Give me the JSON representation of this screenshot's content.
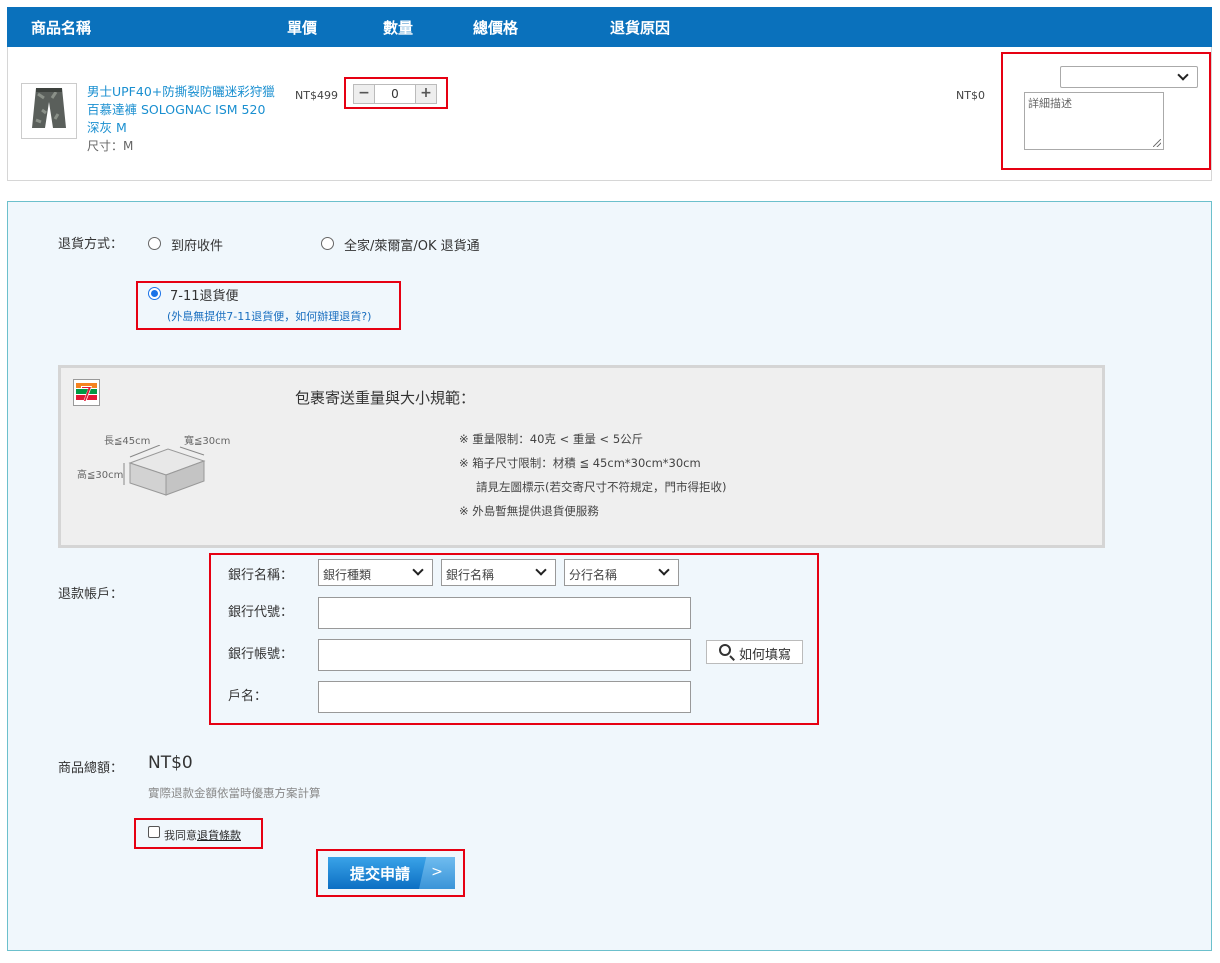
{
  "table": {
    "headers": [
      "商品名稱",
      "單價",
      "數量",
      "總價格",
      "退貨原因"
    ]
  },
  "product": {
    "name": "男士UPF40+防撕裂防曬迷彩狩獵百慕達褲 SOLOGNAC ISM 520 深灰 M",
    "size": "尺寸：M",
    "price": "NT$499",
    "qty": "0",
    "minus": "−",
    "plus": "+",
    "total": "NT$0",
    "reason_selected": "",
    "reason_placeholder": "詳細描述"
  },
  "return_method": {
    "label": "退貨方式：",
    "options": [
      "到府收件",
      "全家/萊爾富/OK 退貨通",
      "7-11退貨便"
    ],
    "selected": "7-11退貨便",
    "note": "(外島無提供7-11退貨便，如何辦理退貨?)"
  },
  "shipping_info": {
    "title": "包裹寄送重量與大小規範：",
    "rules": [
      "※ 重量限制：40克 < 重量 < 5公斤",
      "※ 箱子尺寸限制：材積 ≦ 45cm*30cm*30cm",
      "請見左圖標示(若交寄尺寸不符規定，門市得拒收)",
      "※ 外島暫無提供退貨便服務"
    ],
    "dims": {
      "length": "長≦45cm",
      "width": "寬≦30cm",
      "height": "高≦30cm"
    }
  },
  "refund_account": {
    "label": "退款帳戶：",
    "bank_name_label": "銀行名稱：",
    "bank_type": "銀行種類",
    "bank_name": "銀行名稱",
    "branch_name": "分行名稱",
    "bank_code_label": "銀行代號：",
    "account_no_label": "銀行帳號：",
    "holder_label": "戶名：",
    "how_to_fill": "如何填寫"
  },
  "summary": {
    "label": "商品總額：",
    "amount": "NT$0",
    "note": "實際退款金額依當時優惠方案計算",
    "agree_prefix": "我同意",
    "agree_link": "退貨條款"
  },
  "submit": {
    "label": "提交申請",
    "arrow": ">"
  },
  "colors": {
    "header": "#0a71bc",
    "highlight": "#e60012",
    "panel": "#f0f7fc"
  }
}
